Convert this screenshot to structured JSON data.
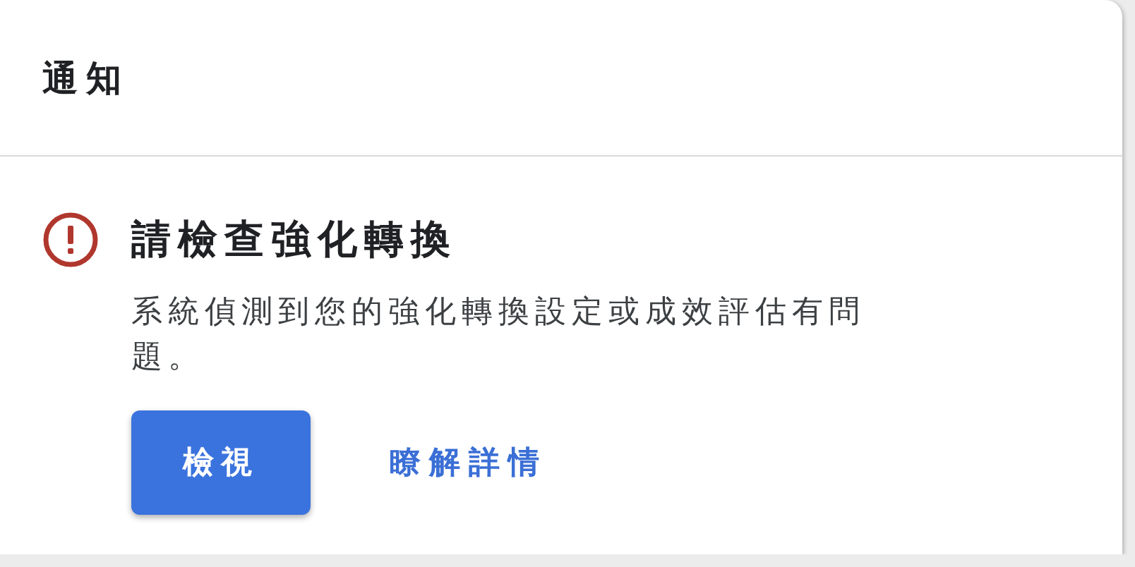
{
  "panel": {
    "title": "通知"
  },
  "notification": {
    "kind": "error",
    "title": "請檢查強化轉換",
    "message": "系統偵測到您的強化轉換設定或成效評估有問題。",
    "primary_button": "檢視",
    "link": "瞭解詳情"
  }
}
